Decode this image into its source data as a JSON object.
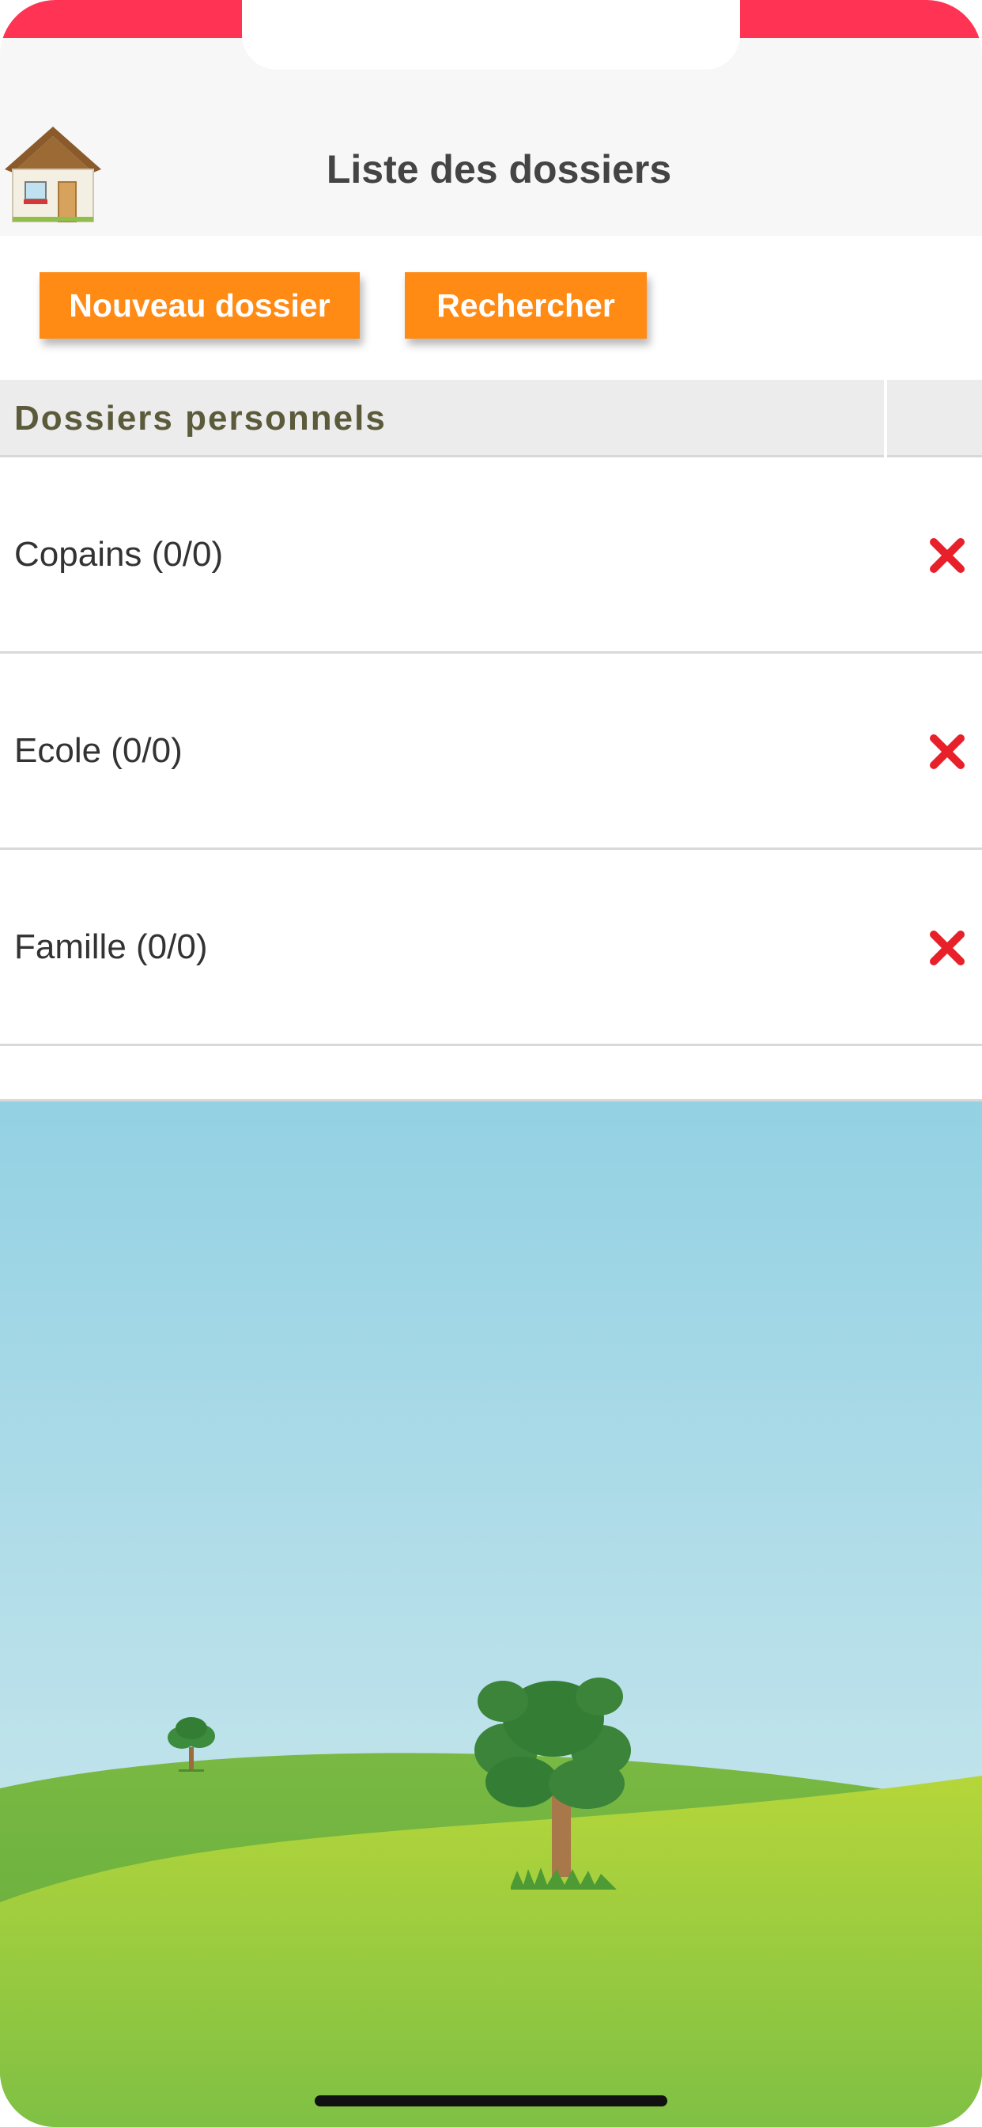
{
  "header": {
    "title": "Liste des dossiers",
    "home_icon": "house-icon"
  },
  "actions": {
    "new_folder_label": "Nouveau dossier",
    "search_label": "Rechercher"
  },
  "section": {
    "title": "Dossiers personnels"
  },
  "folders": [
    {
      "label": "Copains (0/0)",
      "delete_icon": "close-icon"
    },
    {
      "label": "Ecole (0/0)",
      "delete_icon": "close-icon"
    },
    {
      "label": "Famille (0/0)",
      "delete_icon": "close-icon"
    }
  ],
  "colors": {
    "status_accent": "#ff3354",
    "button_orange": "#ff8a14",
    "delete_red": "#e8202a",
    "sky_top": "#93d1e3",
    "hill_green": "#8cc63f"
  }
}
